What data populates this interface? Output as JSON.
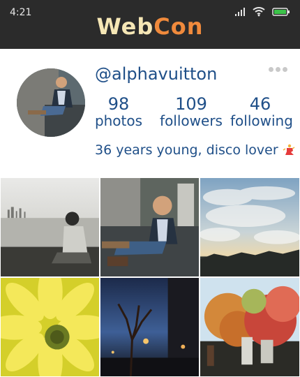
{
  "status": {
    "time": "4:21",
    "icons": [
      "signal-icon",
      "wifi-icon",
      "battery-icon"
    ],
    "battery_color": "#3cc34a"
  },
  "brand": {
    "part1": "Web",
    "part2": "Con"
  },
  "profile": {
    "username": "@alphavuitton",
    "more_icon": "more-dots-icon",
    "stats": [
      {
        "value": "98",
        "label": "photos"
      },
      {
        "value": "109",
        "label": "followers"
      },
      {
        "value": "46",
        "label": "following"
      }
    ],
    "bio": "36 years young, disco lover",
    "bio_emoji": "dancer-emoji"
  },
  "photos": [
    {
      "name": "photo-man-by-sea",
      "description_icon": "photo"
    },
    {
      "name": "photo-man-on-couch",
      "description_icon": "photo"
    },
    {
      "name": "photo-cloudy-sky",
      "description_icon": "photo"
    },
    {
      "name": "photo-yellow-flower",
      "description_icon": "photo"
    },
    {
      "name": "photo-street-night",
      "description_icon": "photo"
    },
    {
      "name": "photo-autumn-trees",
      "description_icon": "photo"
    }
  ],
  "colors": {
    "header_bg": "#2b2b2b",
    "text_blue": "#1f4f88",
    "brand_cream": "#f5e6b5",
    "brand_orange": "#f08a3c"
  }
}
